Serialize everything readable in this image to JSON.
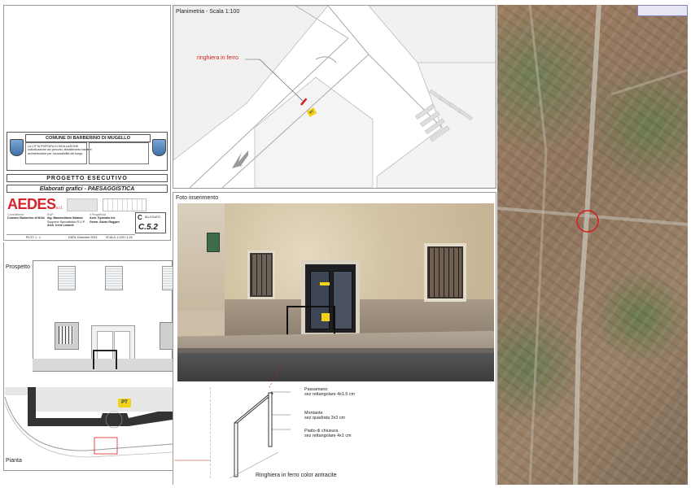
{
  "title_block": {
    "comune": "COMUNE DI BARBERINO DI MUGELLO",
    "intervento_line1": "LA CITTA PORTATA DI SIGILLAZIONE",
    "intervento_line2": "Individuazione dei percorsi, abbattimento barriere",
    "intervento_line3": "architettoniche per l'accessibilità del borgo",
    "progetto": "PROGETTO ESECUTIVO",
    "elaborati": "Elaborati grafici - PAESAGGISTICA",
    "company": "AEDES",
    "company_suffix": "s.r.l.",
    "committente_label": "Committente",
    "committente": "Comune Barberino di M.llo",
    "rup_label": "RUP",
    "rup_line1": "Ing. Massimiliano Salamo",
    "rup_line2": "Supporto Specialistico R.U.P.",
    "rup_line3": "Arch. Irene Lolandi",
    "prog_label": "Il Progettista",
    "prog_line1": "Arch. Spinsalo Iris",
    "prog_line2": "Geom. Sauro Ruggeri",
    "allegato_letter": "C",
    "allegato_label": "ALLEGATO",
    "allegato_code": "C.5.2",
    "plot": "PLOT: 1 : 1",
    "data": "DATA: Dicembre 2023",
    "scala": "SCALA: 1:100 / 1:20"
  },
  "panels": {
    "planimetria": "Planimetria - Scala 1:100",
    "ringhiera_label": "ringhiera in ferro",
    "foto": "Foto inserimento",
    "prospetto": "Prospetto",
    "pianta": "Pianta",
    "pt": "PT"
  },
  "detail": {
    "passamano_1": "Passamano",
    "passamano_2": "sez rettangolare 4x1.5 cm",
    "montante_1": "Montante",
    "montante_2": "sez quadrata 3x3 cm",
    "piatto_1": "Piatto di chiusura",
    "piatto_2": "sez rettangolare 4x1 cm",
    "caption": "Ringhiera in ferro color antracite"
  },
  "colors": {
    "red": "#d42020",
    "aedes_red": "#d6242b",
    "wall": "#d9cbb1",
    "street": "#4a4a4a",
    "aerial": "#8a7a62"
  }
}
